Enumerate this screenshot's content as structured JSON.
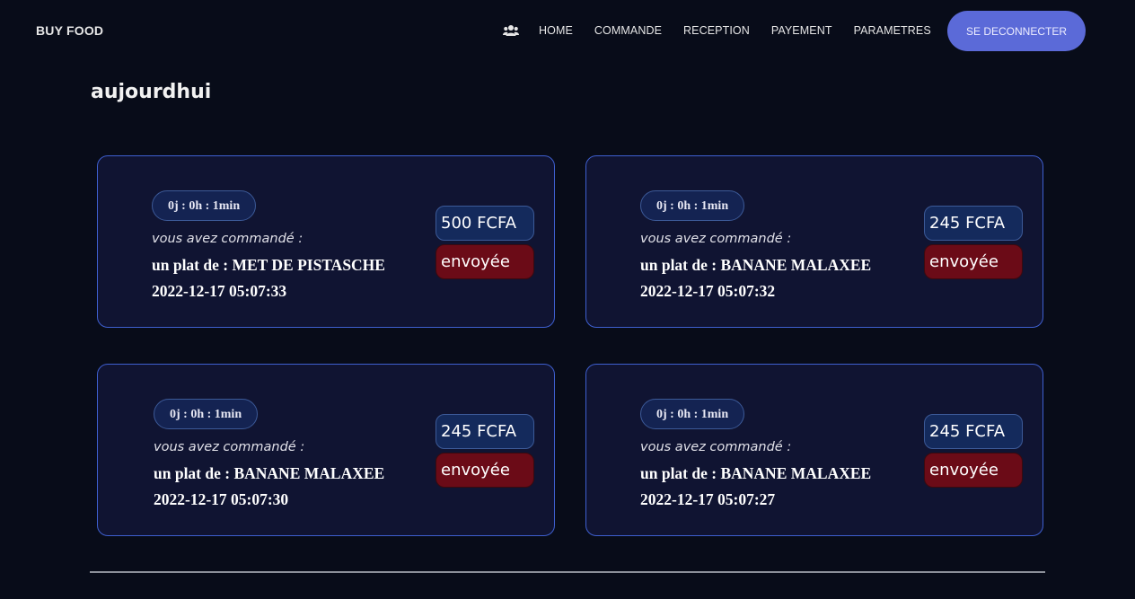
{
  "nav": {
    "brand": "BUY FOOD",
    "icon": "users-icon",
    "links": [
      "HOME",
      "COMMANDE",
      "RECEPTION",
      "PAYEMENT",
      "PARAMETRES"
    ],
    "logout": "SE DECONNECTER"
  },
  "section_title": "aujourdhui",
  "orders": [
    {
      "timer": "0j : 0h : 1min",
      "label": "vous avez commandé :",
      "dish": "un plat de : MET DE PISTASCHE",
      "date": "2022-12-17 05:07:33",
      "price": "500 FCFA",
      "status": "envoyée"
    },
    {
      "timer": "0j : 0h : 1min",
      "label": "vous avez commandé :",
      "dish": "un plat de : BANANE MALAXEE",
      "date": "2022-12-17 05:07:32",
      "price": "245 FCFA",
      "status": "envoyée"
    },
    {
      "timer": "0j : 0h : 1min",
      "label": "vous avez commandé :",
      "dish": "un plat de : BANANE MALAXEE",
      "date": "2022-12-17 05:07:30",
      "price": "245 FCFA",
      "status": "envoyée"
    },
    {
      "timer": "0j : 0h : 1min",
      "label": "vous avez commandé :",
      "dish": "un plat de : BANANE MALAXEE",
      "date": "2022-12-17 05:07:27",
      "price": "245 FCFA",
      "status": "envoyée"
    }
  ],
  "colors": {
    "background": "#080c19",
    "card": "#101432",
    "card_border": "#3e5fcf",
    "accent": "#5b6ad8",
    "status": "#6b0b17"
  }
}
